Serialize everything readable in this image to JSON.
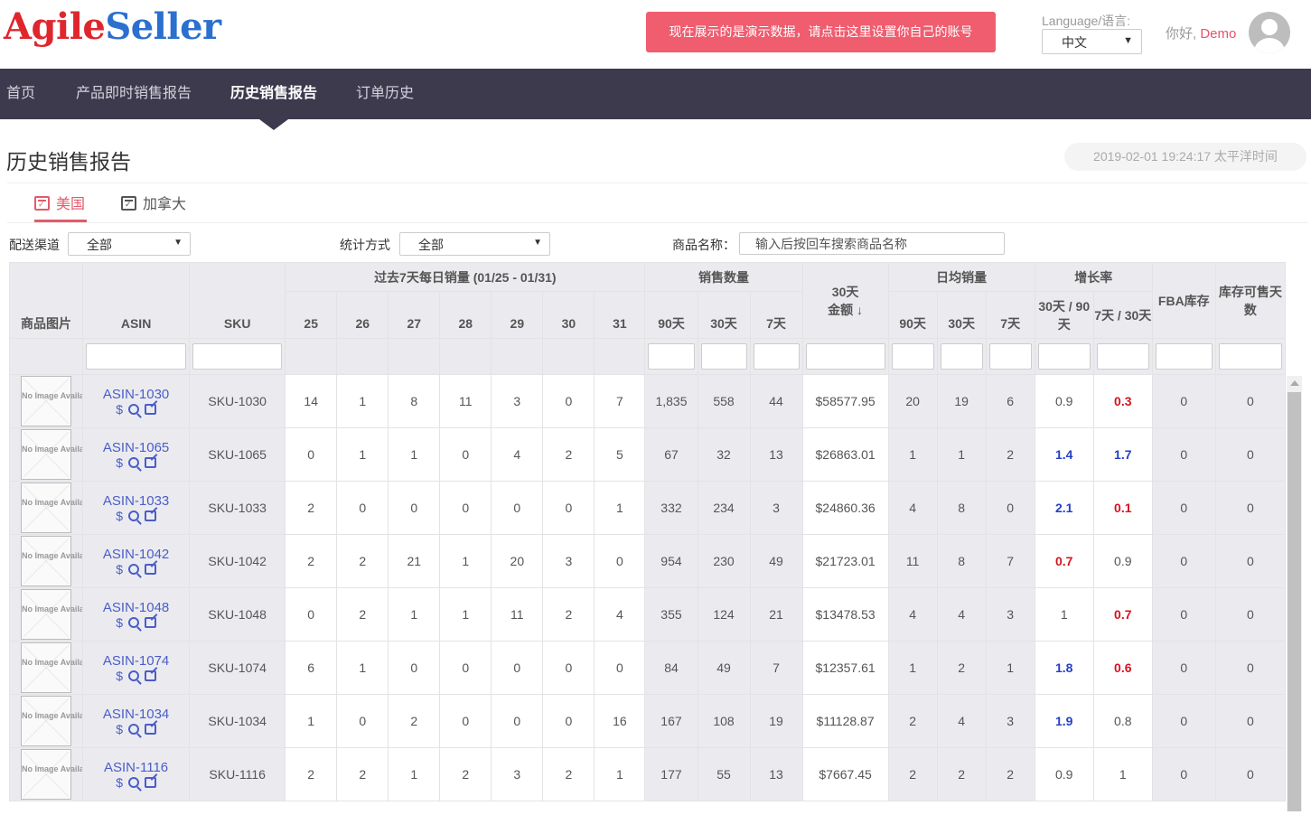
{
  "header": {
    "logo_part1": "Agile",
    "logo_part2": "Seller",
    "demo_banner": "现在展示的是演示数据，请点击这里设置你自己的账号",
    "language_label": "Language/语言:",
    "language_value": "中文",
    "greeting": "你好,",
    "username": "Demo"
  },
  "nav": {
    "items": [
      {
        "label": "首页",
        "active": false
      },
      {
        "label": "产品即时销售报告",
        "active": false
      },
      {
        "label": "历史销售报告",
        "active": true
      },
      {
        "label": "订单历史",
        "active": false
      }
    ]
  },
  "page": {
    "title": "历史销售报告",
    "timestamp": "2019-02-01 19:24:17 太平洋时间"
  },
  "tabs": [
    {
      "label": "美国",
      "active": true,
      "icon": "calendar-check-icon"
    },
    {
      "label": "加拿大",
      "active": false,
      "icon": "calendar-check-icon"
    }
  ],
  "filters": {
    "channel_label": "配送渠道",
    "channel_value": "全部",
    "stat_label": "统计方式",
    "stat_value": "全部",
    "name_label": "商品名称：",
    "name_placeholder": "输入后按回车搜索商品名称"
  },
  "table": {
    "headers": {
      "image": "商品图片",
      "asin": "ASIN",
      "sku": "SKU",
      "daily_group": "过去7天每日销量 (01/25 - 01/31)",
      "days": [
        "25",
        "26",
        "27",
        "28",
        "29",
        "30",
        "31"
      ],
      "qty_group": "销售数量",
      "qty_cols": [
        "90天",
        "30天",
        "7天"
      ],
      "amount_line1": "30天",
      "amount_line2": "金额",
      "amount_sort": "↓",
      "avg_group": "日均销量",
      "avg_cols": [
        "90天",
        "30天",
        "7天"
      ],
      "growth_group": "增长率",
      "growth_cols": [
        "30天 / 90天",
        "7天 / 30天"
      ],
      "fba": "FBA库存",
      "days_left": "库存可售天数"
    },
    "no_image_text": "No Image Available",
    "rows": [
      {
        "asin": "ASIN-1030",
        "sku": "SKU-1030",
        "days": [
          "14",
          "1",
          "8",
          "11",
          "3",
          "0",
          "7"
        ],
        "qty": [
          "1,835",
          "558",
          "44"
        ],
        "amount": "$58577.95",
        "avg": [
          "20",
          "19",
          "6"
        ],
        "g1": "0.9",
        "g1_color": "normal",
        "g2": "0.3",
        "g2_color": "red",
        "fba": "0",
        "days_left": "0"
      },
      {
        "asin": "ASIN-1065",
        "sku": "SKU-1065",
        "days": [
          "0",
          "1",
          "1",
          "0",
          "4",
          "2",
          "5"
        ],
        "qty": [
          "67",
          "32",
          "13"
        ],
        "amount": "$26863.01",
        "avg": [
          "1",
          "1",
          "2"
        ],
        "g1": "1.4",
        "g1_color": "blue",
        "g2": "1.7",
        "g2_color": "blue",
        "fba": "0",
        "days_left": "0"
      },
      {
        "asin": "ASIN-1033",
        "sku": "SKU-1033",
        "days": [
          "2",
          "0",
          "0",
          "0",
          "0",
          "0",
          "1"
        ],
        "qty": [
          "332",
          "234",
          "3"
        ],
        "amount": "$24860.36",
        "avg": [
          "4",
          "8",
          "0"
        ],
        "g1": "2.1",
        "g1_color": "blue",
        "g2": "0.1",
        "g2_color": "red",
        "fba": "0",
        "days_left": "0"
      },
      {
        "asin": "ASIN-1042",
        "sku": "SKU-1042",
        "days": [
          "2",
          "2",
          "21",
          "1",
          "20",
          "3",
          "0"
        ],
        "qty": [
          "954",
          "230",
          "49"
        ],
        "amount": "$21723.01",
        "avg": [
          "11",
          "8",
          "7"
        ],
        "g1": "0.7",
        "g1_color": "red",
        "g2": "0.9",
        "g2_color": "normal",
        "fba": "0",
        "days_left": "0"
      },
      {
        "asin": "ASIN-1048",
        "sku": "SKU-1048",
        "days": [
          "0",
          "2",
          "1",
          "1",
          "11",
          "2",
          "4"
        ],
        "qty": [
          "355",
          "124",
          "21"
        ],
        "amount": "$13478.53",
        "avg": [
          "4",
          "4",
          "3"
        ],
        "g1": "1",
        "g1_color": "normal",
        "g2": "0.7",
        "g2_color": "red",
        "fba": "0",
        "days_left": "0"
      },
      {
        "asin": "ASIN-1074",
        "sku": "SKU-1074",
        "days": [
          "6",
          "1",
          "0",
          "0",
          "0",
          "0",
          "0"
        ],
        "qty": [
          "84",
          "49",
          "7"
        ],
        "amount": "$12357.61",
        "avg": [
          "1",
          "2",
          "1"
        ],
        "g1": "1.8",
        "g1_color": "blue",
        "g2": "0.6",
        "g2_color": "red",
        "fba": "0",
        "days_left": "0"
      },
      {
        "asin": "ASIN-1034",
        "sku": "SKU-1034",
        "days": [
          "1",
          "0",
          "2",
          "0",
          "0",
          "0",
          "16"
        ],
        "qty": [
          "167",
          "108",
          "19"
        ],
        "amount": "$11128.87",
        "avg": [
          "2",
          "4",
          "3"
        ],
        "g1": "1.9",
        "g1_color": "blue",
        "g2": "0.8",
        "g2_color": "normal",
        "fba": "0",
        "days_left": "0"
      },
      {
        "asin": "ASIN-1116",
        "sku": "SKU-1116",
        "days": [
          "2",
          "2",
          "1",
          "2",
          "3",
          "2",
          "1"
        ],
        "qty": [
          "177",
          "55",
          "13"
        ],
        "amount": "$7667.45",
        "avg": [
          "2",
          "2",
          "2"
        ],
        "g1": "0.9",
        "g1_color": "normal",
        "g2": "1",
        "g2_color": "normal",
        "fba": "0",
        "days_left": "0"
      }
    ]
  },
  "colors": {
    "brand_red": "#e0262d",
    "brand_blue": "#2b6fcf",
    "banner": "#ef5d6f",
    "nav_bg": "#3d3a4e",
    "growth_up": "#2540c7",
    "growth_down": "#d5141e"
  }
}
